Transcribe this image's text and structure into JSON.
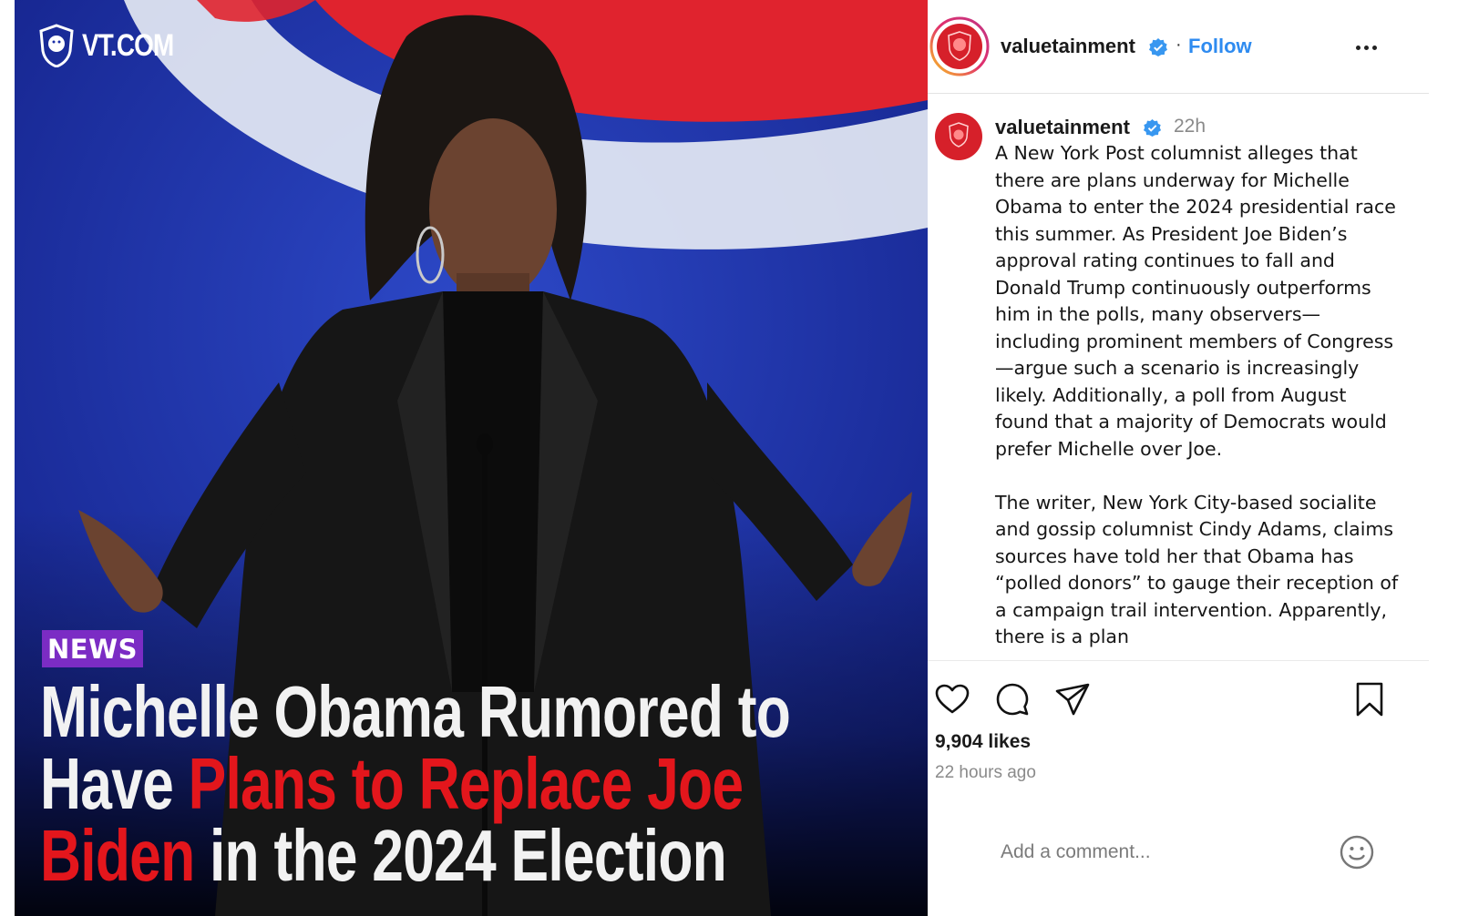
{
  "media": {
    "logo_text": "VT.COM",
    "badge": "NEWS",
    "headline": {
      "line1": "Michelle Obama Rumored to",
      "line2_white": "Have ",
      "line2_red": "Plans to Replace Joe",
      "line3_red": "Biden",
      "line3_white": " in the 2024 Election"
    },
    "colors": {
      "background_blue": "#1a2ea8",
      "accent_red": "#e3161c",
      "badge_purple": "#7b2cc4"
    }
  },
  "post_header": {
    "username": "valuetainment",
    "separator": "·",
    "follow_label": "Follow",
    "more_icon": "more-horizontal-icon"
  },
  "caption": {
    "username": "valuetainment",
    "time": "22h",
    "paragraph1": "A New York Post columnist alleges that there are plans underway for Michelle Obama to enter the 2024 presidential race this summer. As President Joe Biden’s approval rating continues to fall and Donald Trump continuously outperforms him in the polls, many observers—including prominent members of Congress—argue such a scenario is increasingly likely. Additionally, a poll from August found that a majority of Democrats would prefer Michelle over Joe.",
    "paragraph2": "The writer, New York City-based socialite and gossip columnist Cindy Adams, claims sources have told her that Obama has “polled donors” to gauge their reception of a campaign trail intervention. Apparently, there is a plan"
  },
  "actions": {
    "icons": [
      "heart-icon",
      "comment-icon",
      "share-icon",
      "bookmark-icon"
    ]
  },
  "stats": {
    "likes": "9,904 likes",
    "posted": "22 hours ago"
  },
  "comment": {
    "placeholder": "Add a comment...",
    "emoji_icon": "smiley-icon"
  },
  "brand": {
    "follow_blue": "#2e8bf0",
    "verified_blue": "#3897f0",
    "avatar_red": "#d6202a"
  }
}
